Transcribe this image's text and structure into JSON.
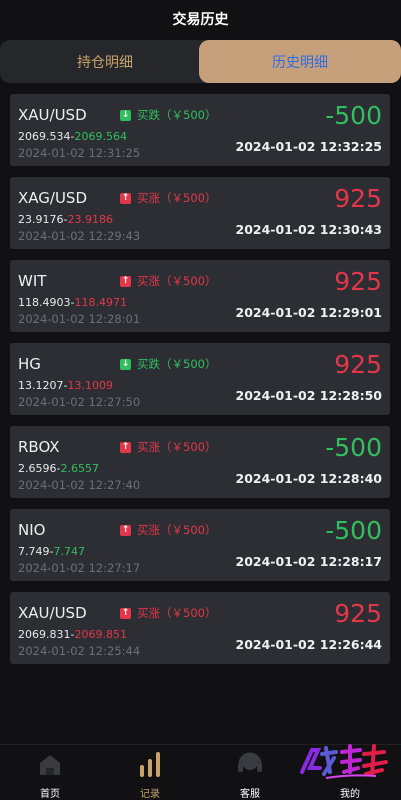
{
  "header": {
    "title": "交易历史"
  },
  "tabs": {
    "holdings": "持仓明细",
    "history": "历史明细"
  },
  "trades": [
    {
      "symbol": "XAU/USD",
      "direction": "买跌（￥500）",
      "dir": "down",
      "open": "2069.534",
      "close": "2069.564",
      "close_color": "up",
      "open_time": "2024-01-02 12:31:25",
      "pl": "-500",
      "pl_color": "up",
      "close_time": "2024-01-02 12:32:25"
    },
    {
      "symbol": "XAG/USD",
      "direction": "买涨（￥500）",
      "dir": "up",
      "open": "23.9176",
      "close": "23.9186",
      "close_color": "down",
      "open_time": "2024-01-02 12:29:43",
      "pl": "925",
      "pl_color": "down",
      "close_time": "2024-01-02 12:30:43"
    },
    {
      "symbol": "WIT",
      "direction": "买涨（￥500）",
      "dir": "up",
      "open": "118.4903",
      "close": "118.4971",
      "close_color": "down",
      "open_time": "2024-01-02 12:28:01",
      "pl": "925",
      "pl_color": "down",
      "close_time": "2024-01-02 12:29:01"
    },
    {
      "symbol": "HG",
      "direction": "买跌（￥500）",
      "dir": "down",
      "open": "13.1207",
      "close": "13.1009",
      "close_color": "down",
      "open_time": "2024-01-02 12:27:50",
      "pl": "925",
      "pl_color": "down",
      "close_time": "2024-01-02 12:28:50"
    },
    {
      "symbol": "RBOX",
      "direction": "买涨（￥500）",
      "dir": "up",
      "open": "2.6596",
      "close": "2.6557",
      "close_color": "up",
      "open_time": "2024-01-02 12:27:40",
      "pl": "-500",
      "pl_color": "up",
      "close_time": "2024-01-02 12:28:40"
    },
    {
      "symbol": "NIO",
      "direction": "买涨（￥500）",
      "dir": "up",
      "open": "7.749",
      "close": "7.747",
      "close_color": "up",
      "open_time": "2024-01-02 12:27:17",
      "pl": "-500",
      "pl_color": "up",
      "close_time": "2024-01-02 12:28:17"
    },
    {
      "symbol": "XAU/USD",
      "direction": "买涨（￥500）",
      "dir": "up",
      "open": "2069.831",
      "close": "2069.851",
      "close_color": "down",
      "open_time": "2024-01-02 12:25:44",
      "pl": "925",
      "pl_color": "down",
      "close_time": "2024-01-02 12:26:44"
    }
  ],
  "nav": [
    {
      "label": "首页",
      "icon": "home-icon"
    },
    {
      "label": "记录",
      "icon": "records-icon",
      "active": true
    },
    {
      "label": "客服",
      "icon": "headset-icon"
    },
    {
      "label": "我的",
      "icon": "user-icon"
    }
  ],
  "logo": {
    "icon": "brand-logo"
  },
  "colors": {
    "up": "#2fbf5f",
    "down": "#e2374a",
    "gold": "#c9a26b",
    "tab_active_bg": "#c6a07a",
    "tab_active_text": "#2f6be0"
  }
}
